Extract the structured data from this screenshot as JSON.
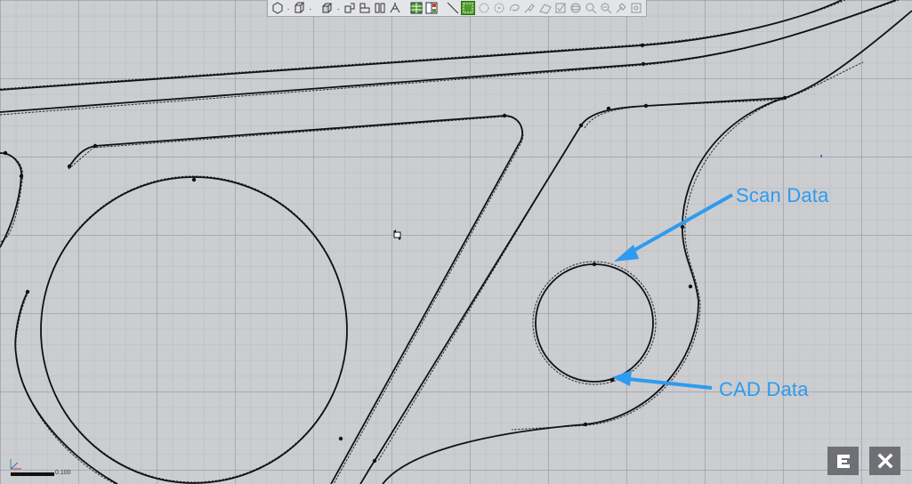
{
  "toolbar": {
    "tools": [
      {
        "icon": "sphere-view-icon"
      },
      {
        "icon": "cube-view-icon"
      },
      {
        "icon": "iso-view-icon"
      },
      {
        "icon": "front-view-icon"
      },
      {
        "icon": "top-view-icon"
      },
      {
        "icon": "side-view-icon"
      },
      {
        "icon": "section-view-icon"
      },
      {
        "icon": "grid-layout-icon"
      },
      {
        "icon": "split-layout-icon"
      },
      {
        "icon": "line-select-icon"
      },
      {
        "icon": "rectangle-select-icon",
        "active": true
      },
      {
        "icon": "circle-select-icon"
      },
      {
        "icon": "target-select-icon"
      },
      {
        "icon": "lasso-select-icon"
      },
      {
        "icon": "paint-select-icon"
      },
      {
        "icon": "surface-select-icon"
      },
      {
        "icon": "checkbox-select-icon"
      },
      {
        "icon": "sphere-select-icon"
      },
      {
        "icon": "zoom-icon"
      },
      {
        "icon": "zoom-fit-icon"
      },
      {
        "icon": "pick-icon"
      },
      {
        "icon": "reset-icon"
      }
    ]
  },
  "annotations": {
    "scan_label": "Scan Data",
    "cad_label": "CAD Data",
    "color": "#2e9bee"
  },
  "scale": {
    "label": "0.100"
  },
  "corner_buttons": {
    "export_icon": "export-icon",
    "close_icon": "close-icon"
  },
  "colors": {
    "background": "#cbcdd1",
    "curve": "#111111",
    "annotation": "#2e9bee",
    "active_tool": "#4f9a2c"
  }
}
